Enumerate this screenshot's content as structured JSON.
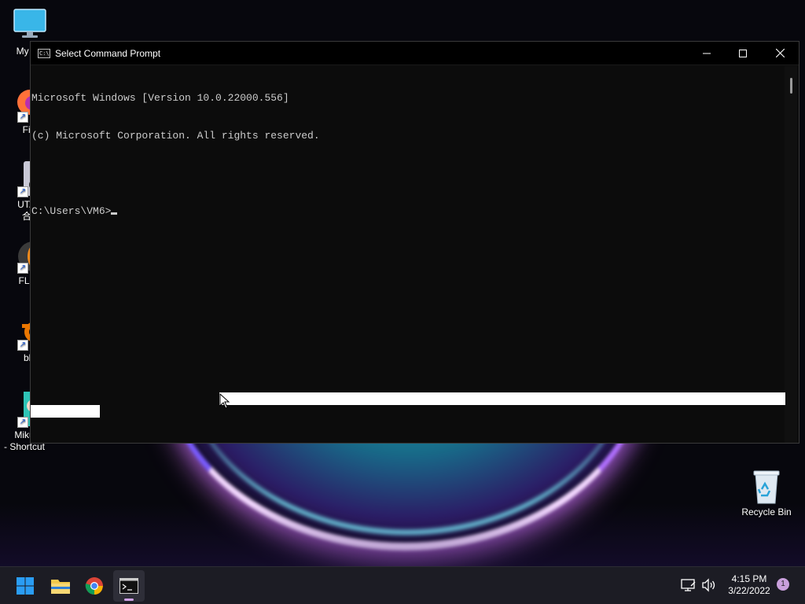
{
  "window": {
    "title": "Select Command Prompt",
    "console_lines": [
      "Microsoft Windows [Version 10.0.22000.556]",
      "(c) Microsoft Corporation. All rights reserved.",
      "",
      "C:\\Users\\VM6>"
    ]
  },
  "desktop": {
    "icons": [
      {
        "label": "My Co",
        "icon": "monitor-icon"
      },
      {
        "label": "Fire",
        "icon": "firefox-icon"
      },
      {
        "label": "UTAU",
        "label2": "合成",
        "icon": "utau-icon"
      },
      {
        "label": "FL Stu",
        "icon": "fl-studio-icon"
      },
      {
        "label": "bler",
        "icon": "blender-icon"
      },
      {
        "label": "MikuM",
        "label2": "- Shortcut",
        "icon": "mikumiku-icon"
      },
      {
        "label": "Recycle Bin",
        "icon": "recycle-bin-icon"
      }
    ]
  },
  "taskbar": {
    "apps": [
      "start-icon",
      "file-explorer-icon",
      "chrome-icon",
      "command-prompt-icon"
    ],
    "time": "4:15 PM",
    "date": "3/22/2022",
    "notification_count": "1"
  },
  "colors": {
    "console_bg": "#0c0c0c",
    "console_text": "#cccccc",
    "taskbar_bg": "#1c1c24",
    "accent": "#d0a2e8"
  }
}
